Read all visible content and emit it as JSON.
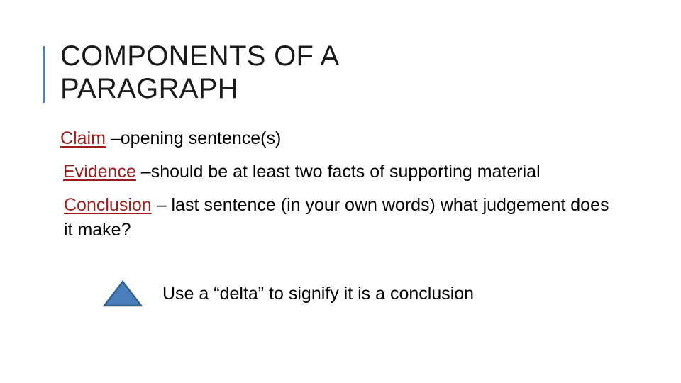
{
  "slide": {
    "background_color": "#FFFFFF",
    "accent_bar_color": "#5B82AC",
    "title": "COMPONENTS OF A PARAGRAPH",
    "title_color": "#1A1A1A",
    "term_color": "#9E1B1B",
    "body_color": "#000000"
  },
  "body": {
    "lines": [
      {
        "term": "Claim",
        "rest": " –opening sentence(s)"
      },
      {
        "term": "Evidence",
        "rest": " –should be at least two facts of supporting material"
      },
      {
        "term": "Conclusion",
        "rest": " – last sentence (in your own words) what judgement does it make?"
      }
    ]
  },
  "delta_bullet": {
    "icon": "delta-triangle-icon",
    "fill_color": "#4A7EBB",
    "stroke_color": "#36618E",
    "text": "Use a “delta” to signify it is a conclusion"
  }
}
